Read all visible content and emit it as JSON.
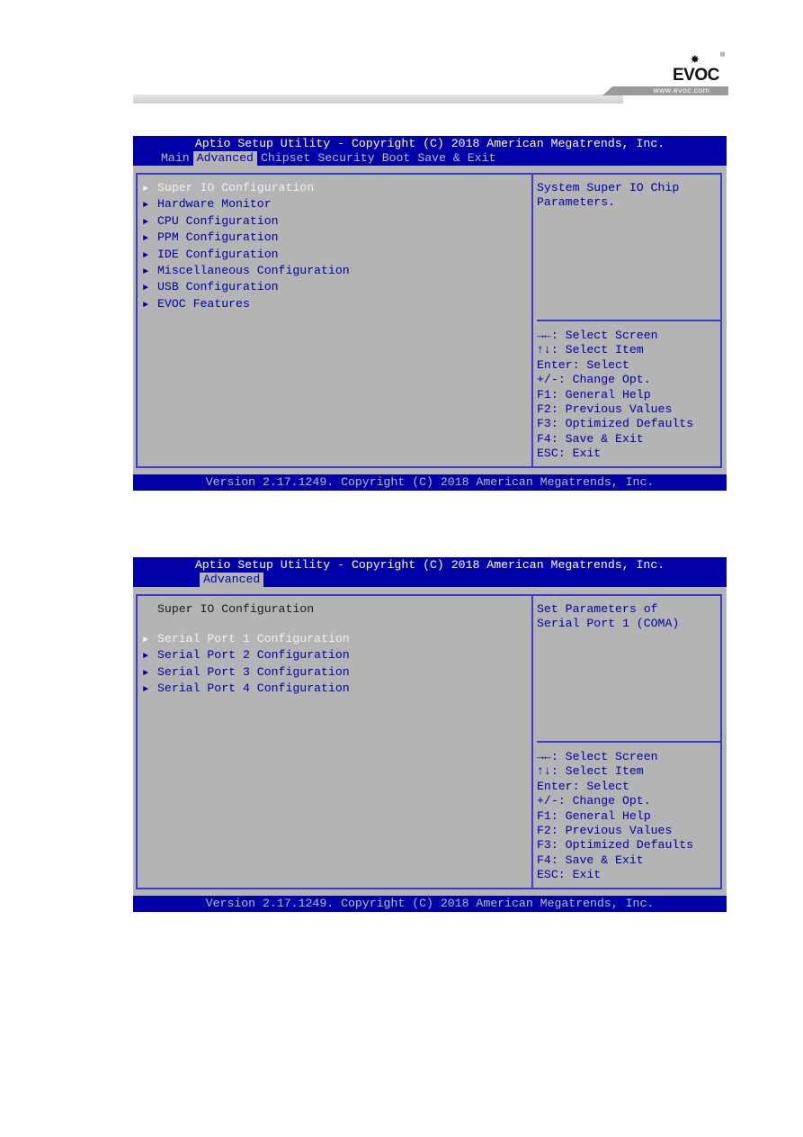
{
  "page_header": {
    "logo_text": "EVOC",
    "logo_star": "✸",
    "registered_mark": "®",
    "url": "www.evoc.com"
  },
  "screens": [
    {
      "title": "Aptio Setup Utility - Copyright (C) 2018 American Megatrends, Inc.",
      "tabs": [
        {
          "label": "Main",
          "active": false
        },
        {
          "label": "Advanced",
          "active": true
        },
        {
          "label": "Chipset",
          "active": false
        },
        {
          "label": "Security",
          "active": false
        },
        {
          "label": "Boot",
          "active": false
        },
        {
          "label": "Save & Exit",
          "active": false
        }
      ],
      "subtitle": null,
      "menu_items": [
        {
          "label": "Super IO Configuration",
          "selected": true
        },
        {
          "label": "Hardware Monitor",
          "selected": false
        },
        {
          "label": "CPU Configuration",
          "selected": false
        },
        {
          "label": "PPM Configuration",
          "selected": false
        },
        {
          "label": "IDE Configuration",
          "selected": false
        },
        {
          "label": "Miscellaneous Configuration",
          "selected": false
        },
        {
          "label": "USB Configuration",
          "selected": false
        },
        {
          "label": "EVOC Features",
          "selected": false
        }
      ],
      "help_text": [
        "System Super IO Chip",
        "Parameters."
      ],
      "key_help": [
        "→←: Select Screen",
        "↑↓: Select Item",
        "Enter: Select",
        "+/-: Change Opt.",
        "F1: General Help",
        "F2: Previous Values",
        "F3: Optimized Defaults",
        "F4: Save & Exit",
        "ESC: Exit"
      ],
      "footer": "Version 2.17.1249. Copyright (C) 2018 American Megatrends, Inc."
    },
    {
      "title": "Aptio Setup Utility - Copyright (C) 2018 American Megatrends, Inc.",
      "tabs": [
        {
          "label": "Advanced",
          "active": true
        }
      ],
      "subtitle": "Super IO Configuration",
      "menu_items": [
        {
          "label": "Serial Port 1 Configuration",
          "selected": true
        },
        {
          "label": "Serial Port 2 Configuration",
          "selected": false
        },
        {
          "label": "Serial Port 3 Configuration",
          "selected": false
        },
        {
          "label": "Serial Port 4 Configuration",
          "selected": false
        }
      ],
      "help_text": [
        "Set Parameters of",
        "Serial Port 1 (COMA)"
      ],
      "key_help": [
        "→←: Select Screen",
        "↑↓: Select Item",
        "Enter: Select",
        "+/-: Change Opt.",
        "F1: General Help",
        "F2: Previous Values",
        "F3: Optimized Defaults",
        "F4: Save & Exit",
        "ESC: Exit"
      ],
      "footer": "Version 2.17.1249. Copyright (C) 2018 American Megatrends, Inc."
    }
  ],
  "icons": {
    "submenu_arrow": "►"
  }
}
